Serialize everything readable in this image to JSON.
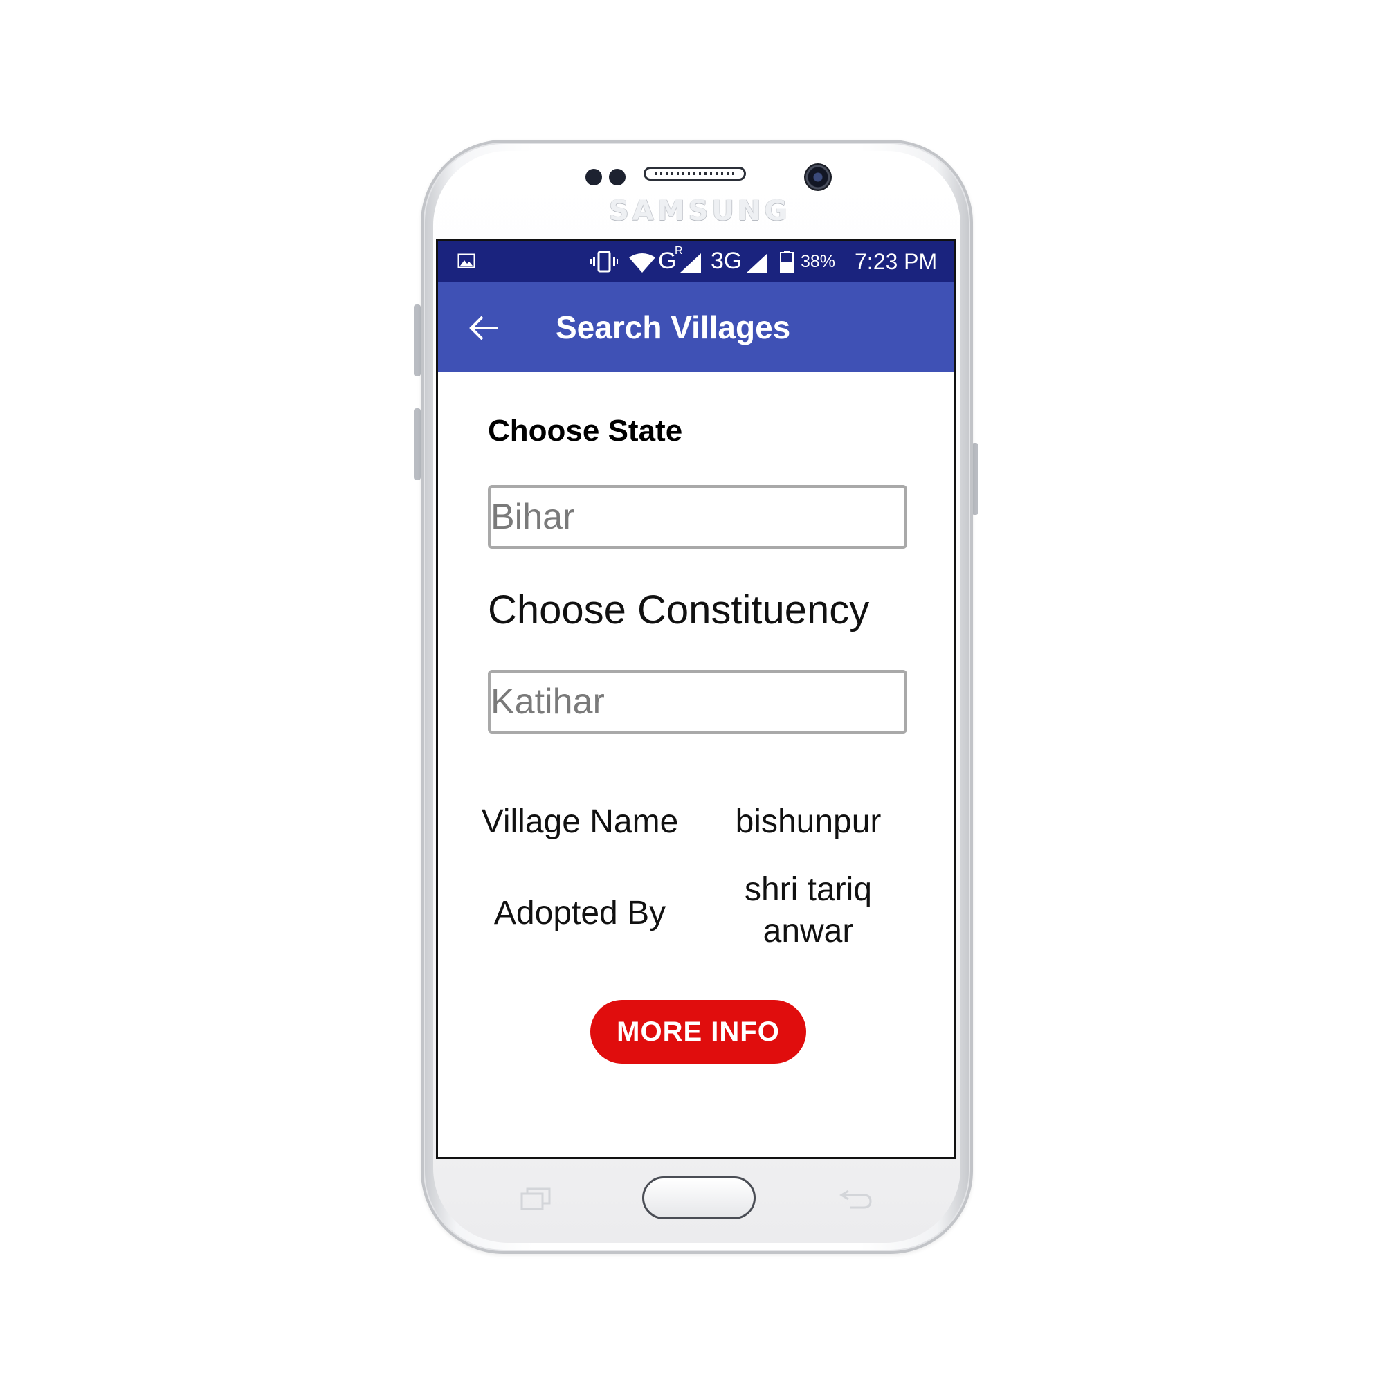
{
  "device": {
    "brand": "SAMSUNG"
  },
  "status_bar": {
    "network_1": "G",
    "network_1_sup": "R",
    "network_2": "3G",
    "battery": "38%",
    "time": "7:23 PM",
    "icons": [
      "gallery-icon",
      "vibrate-icon",
      "wifi-icon",
      "signal-icon",
      "signal-icon",
      "battery-icon"
    ]
  },
  "app_bar": {
    "title": "Search Villages",
    "back_icon": "arrow-left-icon",
    "background": "#3f51b5",
    "status_background": "#1a237e"
  },
  "form": {
    "state_label": "Choose State",
    "state_value": "Bihar",
    "constituency_label": "Choose Constituency",
    "constituency_value": "Katihar"
  },
  "result": {
    "village_label": "Village Name",
    "village_value": "bishunpur",
    "adopted_label": "Adopted By",
    "adopted_value_line1": "shri tariq",
    "adopted_value_line2": "anwar"
  },
  "actions": {
    "more_info_label": "MORE INFO",
    "more_info_color": "#e00d0d"
  }
}
